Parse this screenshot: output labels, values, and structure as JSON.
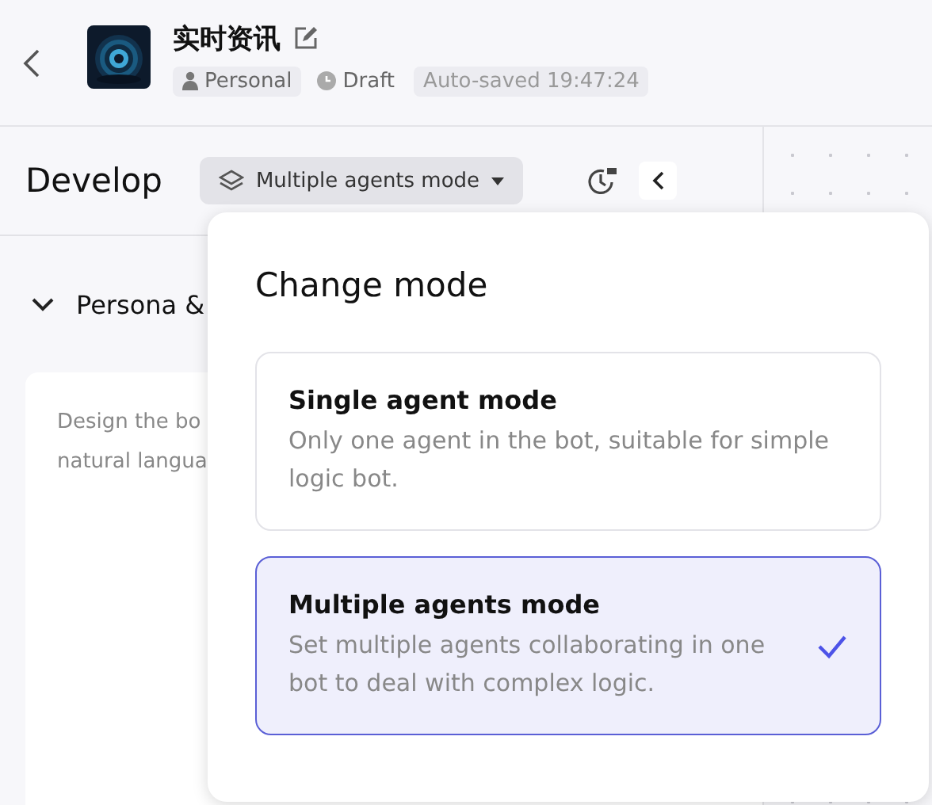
{
  "header": {
    "title": "实时资讯",
    "tags": [
      {
        "kind": "personal",
        "label": "Personal"
      },
      {
        "kind": "draft",
        "label": "Draft"
      },
      {
        "kind": "saved",
        "label": "Auto-saved 19:47:24"
      }
    ]
  },
  "develop": {
    "title": "Develop",
    "mode_button": "Multiple agents mode"
  },
  "section": {
    "title": "Persona &",
    "expanded": true,
    "lines": [
      "Design the bo",
      "natural langua"
    ]
  },
  "popover": {
    "title": "Change mode",
    "options": [
      {
        "title": "Single agent mode",
        "description": "Only one agent in the bot, suitable for simple logic bot.",
        "selected": false
      },
      {
        "title": "Multiple agents mode",
        "description": "Set multiple agents collaborating in one bot to deal with complex logic.",
        "selected": true
      }
    ]
  }
}
